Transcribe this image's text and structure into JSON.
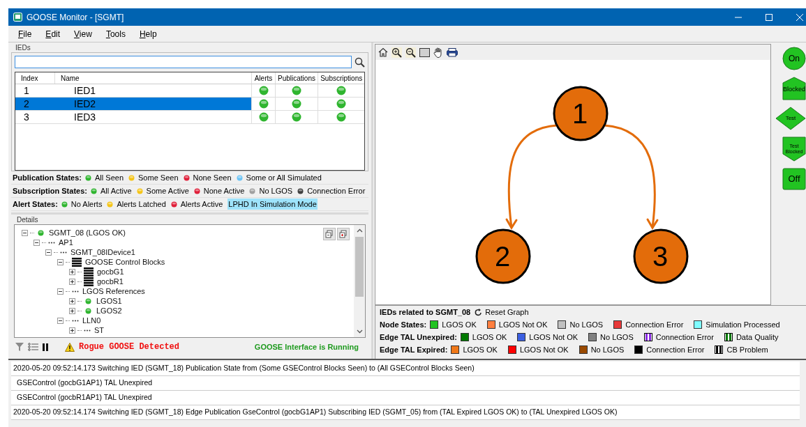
{
  "window": {
    "title": "GOOSE Monitor - [SGMT]"
  },
  "menu": [
    "File",
    "Edit",
    "View",
    "Tools",
    "Help"
  ],
  "ieds": {
    "title": "IEDs",
    "columns": [
      "Index",
      "Name",
      "Alerts",
      "Publications",
      "Subscriptions"
    ],
    "rows": [
      {
        "index": "1",
        "name": "IED1",
        "selected": false,
        "indicators": [
          {
            "color": "#2fb52f"
          },
          {
            "color": "#2fb52f"
          },
          {
            "color": "#2fb52f"
          }
        ]
      },
      {
        "index": "2",
        "name": "IED2",
        "selected": true,
        "indicators": [
          {
            "color": "#2fb52f"
          },
          {
            "color": "#2fb52f"
          },
          {
            "color": "#2fb52f"
          }
        ]
      },
      {
        "index": "3",
        "name": "IED3",
        "selected": false,
        "indicators": [
          {
            "color": "#2fb52f"
          },
          {
            "color": "#2fb52f"
          },
          {
            "color": "#2fb52f"
          }
        ]
      }
    ]
  },
  "state_legends": [
    {
      "label": "Publication States:",
      "items": [
        {
          "label": "All Seen",
          "color": "#2fb52f"
        },
        {
          "label": "Some Seen",
          "color": "#f5c518"
        },
        {
          "label": "None Seen",
          "color": "#e0203a"
        },
        {
          "label": "Some or All Simulated",
          "color": "#6cc4f5"
        }
      ]
    },
    {
      "label": "Subscription States:",
      "items": [
        {
          "label": "All Active",
          "color": "#2fb52f"
        },
        {
          "label": "Some Active",
          "color": "#f5c518"
        },
        {
          "label": "None Active",
          "color": "#e0203a"
        },
        {
          "label": "No LGOS",
          "color": "#a0a0a0"
        },
        {
          "label": "Connection Error",
          "color": "#404040"
        }
      ]
    },
    {
      "label": "Alert States:",
      "items": [
        {
          "label": "No Alerts",
          "kind": "dot",
          "color": "#2fb52f"
        },
        {
          "label": "Alerts Latched",
          "kind": "dot",
          "color": "#f5c518"
        },
        {
          "label": "Alerts Active",
          "kind": "dot",
          "color": "#e0203a"
        },
        {
          "label": "LPHD In Simulation Mode",
          "kind": "highlight",
          "color": "#9ee3fb"
        }
      ]
    }
  ],
  "details": {
    "title": "Details",
    "tree": [
      {
        "label": "SGMT_08 (LGOS OK)",
        "expanded": true,
        "kind": "dot",
        "color": "#2fb52f",
        "children": [
          {
            "label": "AP1",
            "expanded": true,
            "children": [
              {
                "label": "SGMT_08IDevice1",
                "expanded": true,
                "children": [
                  {
                    "label": "GOOSE Control Blocks",
                    "expanded": true,
                    "kind": "blocks",
                    "children": [
                      {
                        "label": "gocbG1",
                        "expanded": false,
                        "kind": "blocks"
                      },
                      {
                        "label": "gocbR1",
                        "expanded": false,
                        "kind": "blocks"
                      }
                    ]
                  },
                  {
                    "label": "LGOS References",
                    "expanded": true,
                    "children": [
                      {
                        "label": "LGOS1",
                        "expanded": false,
                        "kind": "dot",
                        "color": "#2fb52f"
                      },
                      {
                        "label": "LGOS2",
                        "expanded": false,
                        "kind": "dot",
                        "color": "#2fb52f"
                      }
                    ]
                  },
                  {
                    "label": "LLN0",
                    "expanded": true,
                    "children": [
                      {
                        "label": "ST",
                        "expanded": false
                      }
                    ]
                  }
                ]
              }
            ]
          }
        ]
      }
    ]
  },
  "status": {
    "alert": "Rogue GOOSE Detected",
    "interface": "GOOSE Interface is Running"
  },
  "graph": {
    "nodes": [
      {
        "label": "1",
        "color": "#e36c0a"
      },
      {
        "label": "2",
        "color": "#e36c0a"
      },
      {
        "label": "3",
        "color": "#e36c0a"
      }
    ],
    "edges": [
      {
        "color": "#e36c0a"
      },
      {
        "color": "#e36c0a"
      }
    ],
    "shapes": [
      {
        "label": "On",
        "kind": "circle"
      },
      {
        "label": "Blocked",
        "kind": "pentagon"
      },
      {
        "label": "Test",
        "kind": "diamond"
      },
      {
        "label": "Test Blocked",
        "kind": "shield"
      },
      {
        "label": "Off",
        "kind": "square"
      }
    ]
  },
  "graph_legend": {
    "title": "IEDs related to SGMT_08",
    "reset": "Reset Graph",
    "rows": [
      {
        "label": "Node States:",
        "items": [
          {
            "label": "LGOS OK",
            "kind": "solid",
            "color": "#22c322"
          },
          {
            "label": "LGOS Not OK",
            "kind": "solid",
            "color": "#ff7f3f"
          },
          {
            "label": "No LGOS",
            "kind": "solid",
            "color": "#c0c0c0"
          },
          {
            "label": "Connection Error",
            "kind": "solid",
            "color": "#e83a3a"
          },
          {
            "label": "Simulation Processed",
            "kind": "solid",
            "color": "#7ffcff"
          }
        ]
      },
      {
        "label": "Edge TAL Unexpired:",
        "items": [
          {
            "label": "LGOS OK",
            "kind": "solid",
            "color": "#007800"
          },
          {
            "label": "LGOS Not OK",
            "kind": "solid",
            "color": "#3b5fe0"
          },
          {
            "label": "No LGOS",
            "kind": "solid",
            "color": "#808080"
          },
          {
            "label": "Connection Error",
            "kind": "striped",
            "color": "#8a2be2"
          },
          {
            "label": "Data Quality",
            "kind": "striped",
            "color": "#007800"
          }
        ]
      },
      {
        "label": "Edge TAL Expired:",
        "items": [
          {
            "label": "LGOS OK",
            "kind": "solid",
            "color": "#f07818"
          },
          {
            "label": "LGOS Not OK",
            "kind": "solid",
            "color": "#ff0000"
          },
          {
            "label": "No LGOS",
            "kind": "solid",
            "color": "#9a4a00"
          },
          {
            "label": "Connection Error",
            "kind": "solid",
            "color": "#000000"
          },
          {
            "label": "CB Problem",
            "kind": "striped",
            "color": "#000000"
          }
        ]
      }
    ]
  },
  "log": [
    {
      "kind": "entry",
      "text": "2020-05-20 09:52:14.173  Switching IED (SGMT_18) Publication State from (Some GSEControl Blocks Seen) to (All GSEControl Blocks Seen)"
    },
    {
      "kind": "detail",
      "text": "GSEControl (gocbG1AP1) TAL Unexpired"
    },
    {
      "kind": "detail",
      "text": "GSEControl (gocbR1AP1) TAL Unexpired"
    },
    {
      "kind": "entry",
      "text": "2020-05-20 09:52:14.174  Switching IED (SGMT_18) Edge Publication GseControl (gocbG1AP1) Subscribing IED (SGMT_05) from (TAL Expired LGOS OK) to (TAL Unexpired LGOS OK)"
    }
  ]
}
